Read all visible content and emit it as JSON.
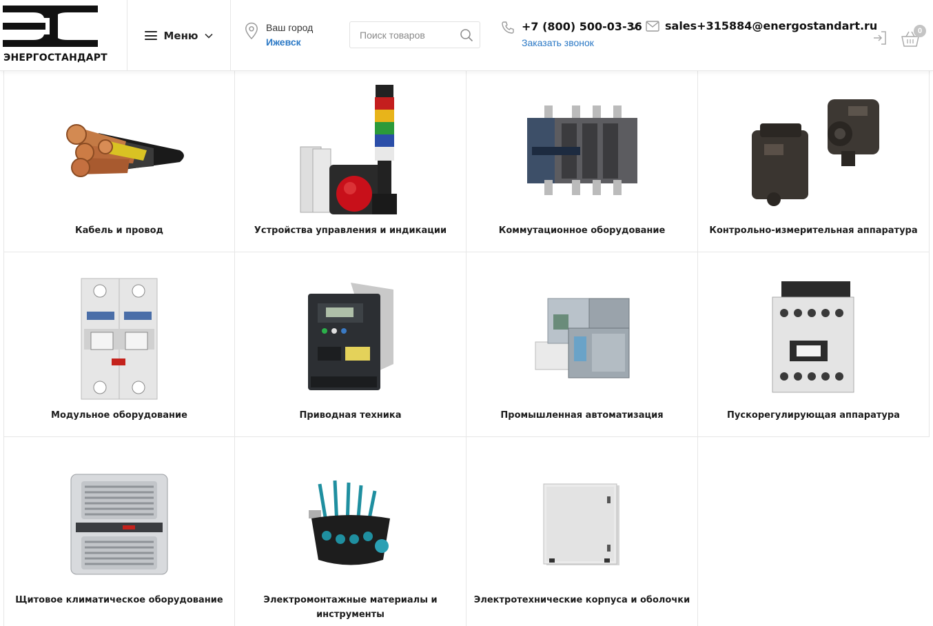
{
  "header": {
    "logo_text": "ЭНЕРГОСТАНДАРТ",
    "menu_label": "Меню",
    "city_caption": "Ваш город",
    "city_value": "Ижевск",
    "search_placeholder": "Поиск товаров",
    "phone": "+7 (800) 500-03-36",
    "callback": "Заказать звонок",
    "email": "sales+315884@energostandart.ru",
    "cart_count": "0"
  },
  "catalog": {
    "categories": [
      {
        "label": "Кабель и провод",
        "icon": "cable-image"
      },
      {
        "label": "Устройства управления и индикации",
        "icon": "signal-tower-image"
      },
      {
        "label": "Коммутационное оборудование",
        "icon": "switch-disconnector-image"
      },
      {
        "label": "Контрольно-измерительная аппаратура",
        "icon": "sensor-image"
      },
      {
        "label": "Модульное оборудование",
        "icon": "circuit-breaker-image"
      },
      {
        "label": "Приводная техника",
        "icon": "frequency-drive-image"
      },
      {
        "label": "Промышленная автоматизация",
        "icon": "plc-image"
      },
      {
        "label": "Пускорегулирующая аппаратура",
        "icon": "contactor-image"
      },
      {
        "label": "Щитовое климатическое оборудование",
        "icon": "cabinet-cooler-image"
      },
      {
        "label": "Электромонтажные материалы и инструменты",
        "icon": "tool-bag-image"
      },
      {
        "label": "Электротехнические корпуса и оболочки",
        "icon": "enclosure-image"
      }
    ]
  },
  "colors": {
    "accent_link": "#2a78c5",
    "text": "#1c1c1c",
    "border": "#e6e6e6",
    "badge": "#c4c4c4"
  }
}
